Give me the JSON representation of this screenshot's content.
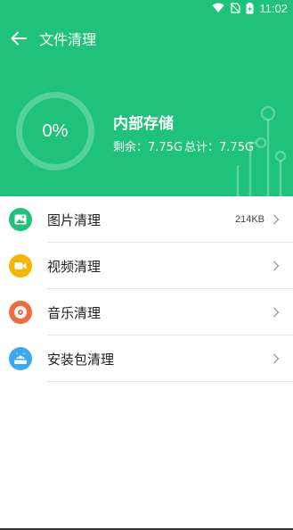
{
  "status_bar": {
    "time": "11:02",
    "icons": [
      "wifi-icon",
      "no-sim-icon",
      "battery-charging-icon"
    ]
  },
  "topbar": {
    "title": "文件清理",
    "back_icon": "arrow-left-icon"
  },
  "storage": {
    "percent": "0%",
    "percent_value": 0,
    "title": "内部存储",
    "remaining": "剩余：7.75G",
    "total": "总计：7.75G"
  },
  "items": [
    {
      "label": "图片清理",
      "size": "214KB",
      "icon": "image-icon",
      "color": "#1ec27a"
    },
    {
      "label": "视频清理",
      "size": "",
      "icon": "video-icon",
      "color": "#f7b500"
    },
    {
      "label": "音乐清理",
      "size": "",
      "icon": "music-disc-icon",
      "color": "#f26a3d"
    },
    {
      "label": "安装包清理",
      "size": "",
      "icon": "apk-icon",
      "color": "#3aa8f5"
    }
  ],
  "colors": {
    "accent": "#1ec27a",
    "divider": "#e6e6e6"
  }
}
